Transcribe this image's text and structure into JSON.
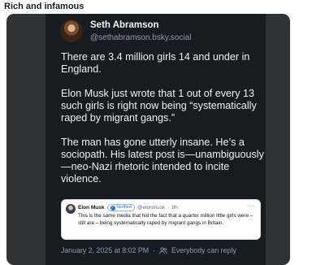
{
  "caption": "Rich and infamous",
  "post": {
    "display_name": "Seth Abramson",
    "handle": "@sethabramson.bsky.social",
    "text": "There are 3.4 million girls 14 and under in England.\n\nElon Musk just wrote that 1 out of every 13 such girls is right now being “systematically raped by migrant gangs.”\n\nThe man has gone utterly insane. He’s a sociopath. His latest post is—unambiguously—neo-Nazi rhetoric intended to incite violence.",
    "timestamp": "January 2, 2025 at 8:02 PM",
    "reply_setting": "Everybody can reply"
  },
  "quoted_post": {
    "display_name": "Elon Musk",
    "verified_label": "Verified",
    "handle": "@elonmusk",
    "age": "8h",
    "more_label": "···",
    "text": "This is the same media that hid the fact that a quarter million little girls were – still are – being systematically raped by migrant gangs in Britain."
  },
  "colors": {
    "card_bg": "#171c22",
    "frame_bg": "#303234",
    "accent": "#1d6fd6"
  }
}
